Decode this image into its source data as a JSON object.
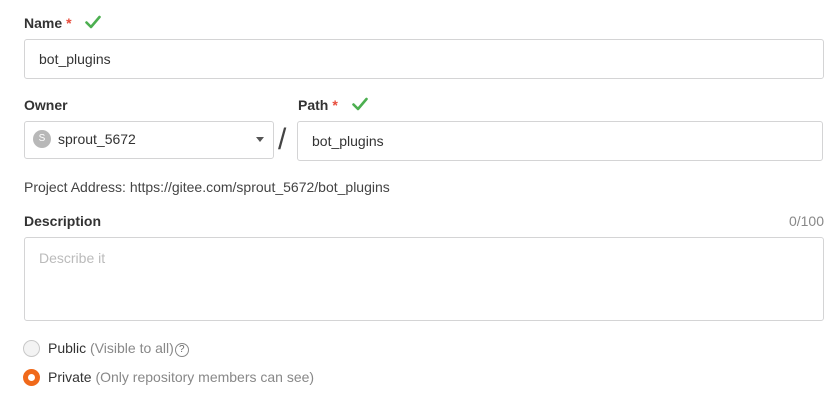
{
  "name_field": {
    "label": "Name",
    "required_mark": "*",
    "value": "bot_plugins"
  },
  "owner_field": {
    "label": "Owner",
    "avatar_letter": "S",
    "selected": "sprout_5672"
  },
  "separator": "/",
  "path_field": {
    "label": "Path",
    "required_mark": "*",
    "value": "bot_plugins"
  },
  "project_address": "Project Address: https://gitee.com/sprout_5672/bot_plugins",
  "description_field": {
    "label": "Description",
    "counter": "0/100",
    "placeholder": "Describe it",
    "value": ""
  },
  "visibility": {
    "public_label": "Public",
    "public_note": "(Visible to all)",
    "help_glyph": "?",
    "private_label": "Private",
    "private_note": "(Only repository members can see)",
    "selected": "private"
  },
  "colors": {
    "accent": "#f0691a",
    "valid_check": "#4caf50",
    "required": "#e74c3c"
  },
  "icons": {
    "valid": "checkmark-icon",
    "dropdown": "caret-down-icon",
    "help": "question-circle-icon"
  }
}
